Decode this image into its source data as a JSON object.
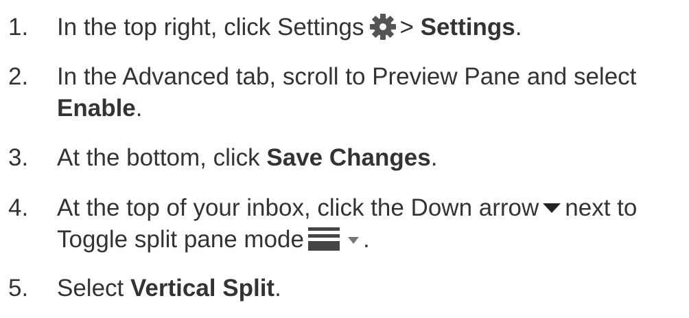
{
  "steps": [
    {
      "num": "1.",
      "lines": [
        {
          "before_icon": "In the top right, click Settings",
          "icon": "gear-icon",
          "after_icon": "> ",
          "bold": "Settings",
          "end": "."
        }
      ]
    },
    {
      "num": "2.",
      "line1": "In the Advanced tab, scroll to Preview Pane and select",
      "bold": "Enable",
      "end": "."
    },
    {
      "num": "3.",
      "text": "At the bottom, click ",
      "bold": "Save Changes",
      "end": "."
    },
    {
      "num": "4.",
      "line1_before": "At the top of your inbox, click the Down arrow",
      "line1_icon": "caret-down-icon",
      "line1_after": "next to",
      "line2_before": "Toggle split pane mode",
      "line2_icon": "split-pane-icon",
      "line2_icon2": "caret-down-small-icon",
      "line2_end": "."
    },
    {
      "num": "5.",
      "text": "Select ",
      "bold": "Vertical Split",
      "end": "."
    }
  ],
  "colors": {
    "text": "#333333",
    "icon_gear": "#555555",
    "icon_caret": "#222222",
    "icon_split": "#444444",
    "icon_caret_light": "#777777"
  }
}
